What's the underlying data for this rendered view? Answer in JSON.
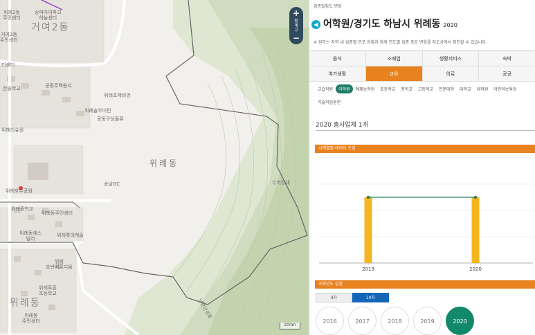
{
  "map": {
    "labels": [
      {
        "text": "위례2동\n주민센터",
        "cls": ""
      },
      {
        "text": "거여2동",
        "cls": "big"
      },
      {
        "text": "송파아이파크\n하늘센터",
        "cls": ""
      },
      {
        "text": "거여2동\n주민센터",
        "cls": ""
      },
      {
        "text": "리센터",
        "cls": ""
      },
      {
        "text": "한솔학교",
        "cls": ""
      },
      {
        "text": "공동주택용지",
        "cls": ""
      },
      {
        "text": "위례초제비엉",
        "cls": ""
      },
      {
        "text": "위례솔우미린",
        "cls": ""
      },
      {
        "text": "공동구상물류",
        "cls": ""
      },
      {
        "text": "위례리슈원",
        "cls": ""
      },
      {
        "text": "위례동",
        "cls": "mid"
      },
      {
        "text": "송남GC",
        "cls": ""
      },
      {
        "text": "수어장대",
        "cls": ""
      },
      {
        "text": "위례호수공원",
        "cls": ""
      },
      {
        "text": "위례중학교",
        "cls": ""
      },
      {
        "text": "위례동주민센터",
        "cls": ""
      },
      {
        "text": "위례동에스\n빌라",
        "cls": ""
      },
      {
        "text": "위례롯데캐슬",
        "cls": ""
      },
      {
        "text": "위례\n호반베르디움",
        "cls": ""
      },
      {
        "text": "위례동",
        "cls": "big"
      },
      {
        "text": "위례푸른\n초등학교",
        "cls": ""
      },
      {
        "text": "위례동\n주민센터",
        "cls": ""
      },
      {
        "text": "남한산성로",
        "cls": ""
      }
    ],
    "zoom": {
      "plus": "+",
      "label": "접계구",
      "minus": "−"
    },
    "scale": "200m"
  },
  "panel": {
    "breadcrumb": "업종밀집도 변화",
    "back_icon": "◀",
    "title": "어학원/경기도 하남시 위례동",
    "title_year": "2020",
    "description": "※ 원하는 지역 내 업종별 분포 현황과 함께 연도별 업종 증감 변화를 지도상에서 확인할 수 있습니다.",
    "categories": [
      {
        "label": "음식",
        "active": false
      },
      {
        "label": "소매업",
        "active": false
      },
      {
        "label": "생활서비스",
        "active": false
      },
      {
        "label": "숙박",
        "active": false
      },
      {
        "label": "여가생활",
        "active": false
      },
      {
        "label": "교육",
        "active": true
      },
      {
        "label": "의료",
        "active": false
      },
      {
        "label": "공공",
        "active": false
      }
    ],
    "subcategories": [
      {
        "label": "교습학원",
        "active": false
      },
      {
        "label": "어학원",
        "active": true
      },
      {
        "label": "예체능학원",
        "active": false
      },
      {
        "label": "초등학교",
        "active": false
      },
      {
        "label": "중학교",
        "active": false
      },
      {
        "label": "고등학교",
        "active": false
      },
      {
        "label": "전문대학",
        "active": false
      },
      {
        "label": "대학교",
        "active": false
      },
      {
        "label": "대학원",
        "active": false
      },
      {
        "label": "어린이보육업",
        "active": false
      },
      {
        "label": "기술직업훈련",
        "active": false
      }
    ],
    "total_text": "2020 총사업체 1개",
    "timeseries_header": "시계열별 데이터 조회",
    "year_header": "조회년도 설정",
    "toggles": [
      {
        "label": "9차",
        "active": false
      },
      {
        "label": "10차",
        "active": true
      }
    ],
    "years": [
      {
        "label": "2016",
        "active": false
      },
      {
        "label": "2017",
        "active": false
      },
      {
        "label": "2018",
        "active": false
      },
      {
        "label": "2019",
        "active": false
      },
      {
        "label": "2020",
        "active": true
      }
    ]
  },
  "chart_data": {
    "type": "bar",
    "categories": [
      "2019",
      "2020"
    ],
    "values": [
      1,
      1
    ],
    "ylim": [
      0,
      1.6
    ],
    "bar_color": "#f5b51e",
    "line_color": "#2e7d5b",
    "grid": true
  }
}
